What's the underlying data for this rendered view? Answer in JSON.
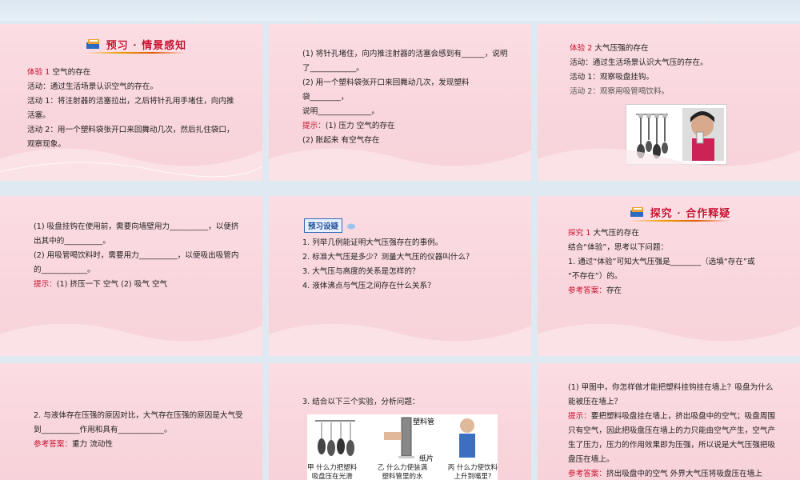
{
  "slide1": {
    "header": "预习 · 情景感知",
    "lines": [
      {
        "a": "体验  1",
        "b": "    空气的存在"
      },
      "活动：通过生活场景认识空气的存在。",
      "活动 1：将注射器的活塞拉出，之后将针孔用手堵住，向内推",
      "活塞。",
      "活动 2：用一个塑料袋张开口来回舞动几次，然后扎住袋口，",
      "观察现象。"
    ]
  },
  "slide2": {
    "lines": [
      "(1) 将针孔堵住，向内推注射器的活塞会感到有______，说明",
      "了____________。",
      "(2) 用一个塑料袋张开口来回舞动几次，发现塑料",
      "袋________，",
      "说明______________。"
    ],
    "hint": {
      "label": "提示：",
      "l1": "(1) 压力   空气的存在",
      "l2": "(2) 胀起来   有空气存在"
    }
  },
  "slide3": {
    "lines": [
      {
        "a": "体验  2",
        "b": "    大气压强的存在"
      },
      "活动：通过生活场景认识大气压的存在。",
      "活动 1：观察吸盘挂钩。",
      "活动 2：观察用吸管喝饮料。"
    ]
  },
  "slide4": {
    "lines": [
      "(1) 吸盘挂钩在使用前，需要向墙壁用力__________，以便挤",
      "出其中的__________。",
      "(2) 用吸管喝饮料时，需要用力__________，以便吸出吸管内",
      "的____________。"
    ],
    "hint": {
      "label": "提示：",
      "text": "(1) 挤压一下   空气   (2) 吸气   空气"
    }
  },
  "slide5": {
    "badge": "预习设疑",
    "lines": [
      "1. 列举几例能证明大气压强存在的事例。",
      "2. 标准大气压是多少？测量大气压的仪器叫什么？",
      "3. 大气压与高度的关系是怎样的？",
      "4. 液体沸点与气压之间存在什么关系？"
    ]
  },
  "slide6": {
    "header": "探究 · 合作释疑",
    "lines": [
      {
        "a": "探究  1",
        "b": "    大气压的存在"
      },
      "结合“体验”，思考以下问题：",
      "1. 通过“体验”可知大气压强是________（选填“存在”或",
      "“不存在”）的。"
    ],
    "answer": {
      "label": "参考答案：",
      "text": "存在"
    }
  },
  "slide7": {
    "lines": [
      "2. 与液体存在压强的原因对比，大气存在压强的原因是大气受",
      "到__________作用和具有____________。"
    ],
    "answer": {
      "label": "参考答案：",
      "text": "重力   流动性"
    }
  },
  "slide8": {
    "question": "3. 结合以下三个实验，分析问题：",
    "img_labels": {
      "tube": "塑料管",
      "paper": "纸片"
    },
    "captions": [
      {
        "l1": "甲 什么力把塑料",
        "l2": "吸盘压在光滑"
      },
      {
        "l1": "乙 什么力使装满",
        "l2": "塑料管里的水"
      },
      {
        "l1": "丙 什么力使饮料",
        "l2": "上升到嘴里?"
      }
    ]
  },
  "slide9": {
    "lines": [
      "(1) 甲图中，你怎样做才能把塑料挂钩挂在墙上？吸盘为什么",
      "能被压在墙上？"
    ],
    "hint": {
      "label": "提示：",
      "l1": "要把塑料吸盘挂在墙上，挤出吸盘中的空气；吸盘周围",
      "rest": [
        "只有空气，因此把吸盘压在墙上的力只能由空气产生，空气产",
        "生了压力，压力的作用效果即为压强，所以说是大气压强把吸",
        "盘压在墙上。"
      ]
    },
    "answer": {
      "label": "参考答案：",
      "text": "挤出吸盘中的空气   外界大气压将吸盘压在墙上"
    }
  },
  "colors": {
    "accent": "#c8102e",
    "slide_bg": "#f9d6dd",
    "page_bg": "#dfe9f1"
  }
}
